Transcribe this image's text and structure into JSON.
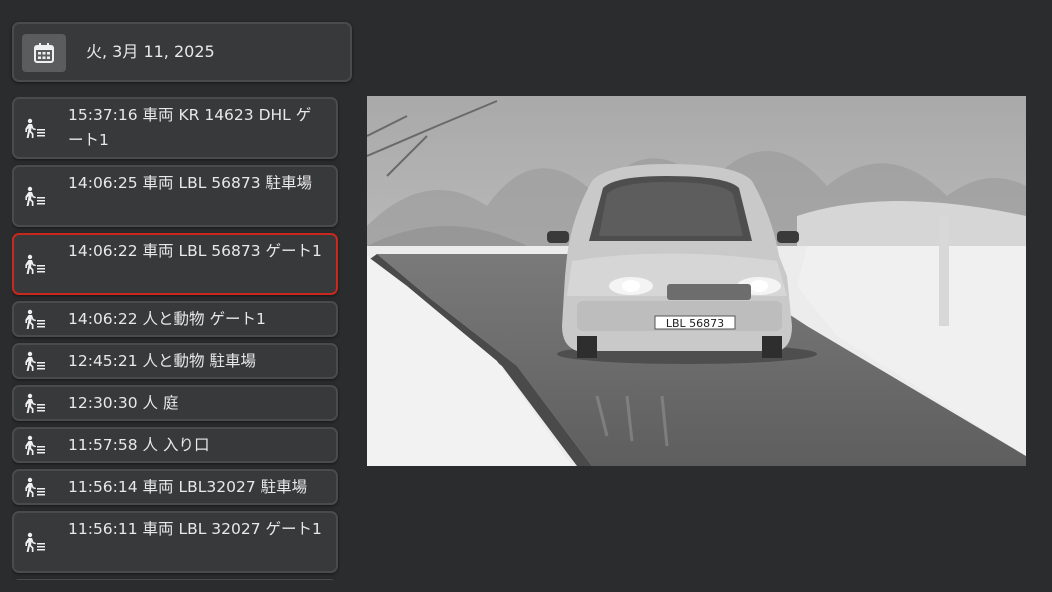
{
  "date_bar": {
    "icon": "calendar-icon",
    "date": "火, 3月 11, 2025"
  },
  "events": [
    {
      "text": "15:37:16 車両 KR 14623 DHL ゲート1",
      "icon": "person-motion-icon",
      "selected": false
    },
    {
      "text": "14:06:25 車両 LBL 56873 駐車場",
      "icon": "person-motion-icon",
      "selected": false
    },
    {
      "text": "14:06:22 車両 LBL 56873 ゲート1",
      "icon": "person-motion-icon",
      "selected": true
    },
    {
      "text": "14:06:22 人と動物 ゲート1",
      "icon": "person-motion-icon",
      "selected": false
    },
    {
      "text": "12:45:21 人と動物 駐車場",
      "icon": "person-motion-icon",
      "selected": false
    },
    {
      "text": "12:30:30 人 庭",
      "icon": "person-motion-icon",
      "selected": false
    },
    {
      "text": "11:57:58 人 入り口",
      "icon": "person-motion-icon",
      "selected": false
    },
    {
      "text": "11:56:14 車両 LBL32027 駐車場",
      "icon": "person-motion-icon",
      "selected": false
    },
    {
      "text": "11:56:11 車両 LBL 32027 ゲート1",
      "icon": "person-motion-icon",
      "selected": false
    }
  ],
  "snapshot": {
    "plate": "LBL 56873"
  },
  "colors": {
    "background": "#2b2c2e",
    "card": "#38393b",
    "selected_border": "#c8281e"
  }
}
